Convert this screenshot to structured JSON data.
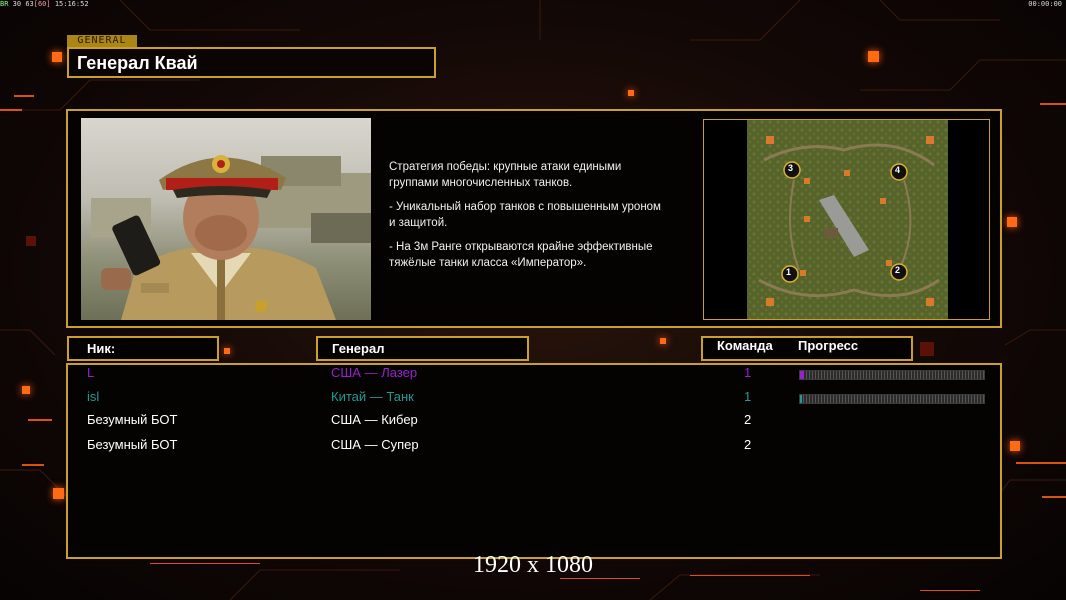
{
  "hud": {
    "stats_prefix": "BR",
    "fps": "30",
    "fps_cap": "63",
    "fps_limit": "[60]",
    "clock": "15:16:52",
    "timer": "00:00:00"
  },
  "general": {
    "tab_label": "GENERAL",
    "name": "Генерал Квай",
    "description": [
      "Стратегия победы: крупные атаки едиными\n группами многочисленных танков.",
      "- Уникальный набор танков с повышенным уроном\n  и защитой.",
      "- На 3м Ранге открываются крайне эффективные\n  тяжёлые танки класса «Император»."
    ]
  },
  "map": {
    "start_positions": [
      "3",
      "4",
      "1",
      "2"
    ]
  },
  "columns": {
    "nick": "Ник:",
    "general": "Генерал",
    "team": "Команда",
    "progress": "Прогресс"
  },
  "players": [
    {
      "nick": "L",
      "general": "США — Лазер",
      "team": "1",
      "color": "#9a1fd1",
      "progress": 0.02
    },
    {
      "nick": "isl",
      "general": "Китай — Танк",
      "team": "1",
      "color": "#1f9a97",
      "progress": 0.01
    },
    {
      "nick": "Безумный БОТ",
      "general": "США — Кибер",
      "team": "2",
      "color": "#ffffff",
      "progress": null
    },
    {
      "nick": "Безумный БОТ",
      "general": "США — Супер",
      "team": "2",
      "color": "#ffffff",
      "progress": null
    }
  ],
  "resolution": "1920 x 1080"
}
